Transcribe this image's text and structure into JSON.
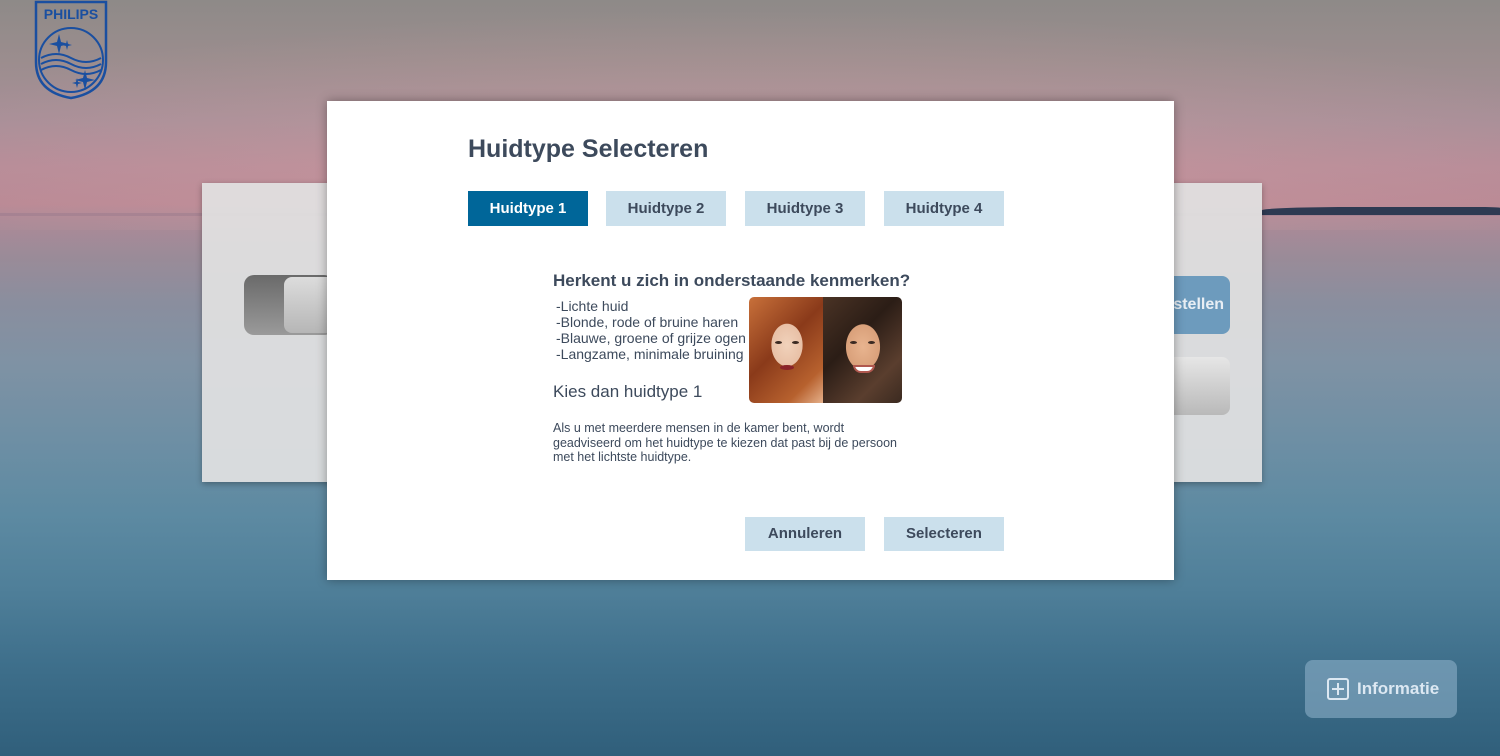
{
  "brand": {
    "name": "PHILIPS"
  },
  "background": {
    "blue_button_label": "stellen",
    "info_button_label": "Informatie"
  },
  "dialog": {
    "title": "Huidtype Selecteren",
    "tabs": [
      {
        "label": "Huidtype 1",
        "active": true
      },
      {
        "label": "Huidtype 2",
        "active": false
      },
      {
        "label": "Huidtype 3",
        "active": false
      },
      {
        "label": "Huidtype 4",
        "active": false
      }
    ],
    "question": "Herkent u zich in onderstaande kenmerken?",
    "traits": [
      "-Lichte huid",
      "-Blonde, rode of bruine haren",
      "-Blauwe, groene of grijze ogen",
      "-Langzame, minimale bruining"
    ],
    "choose_text": "Kies dan huidtype 1",
    "note": "Als u met meerdere mensen in de kamer bent, wordt geadviseerd om het huidtype te kiezen dat past bij de persoon met het lichtste huidtype.",
    "cancel_label": "Annuleren",
    "select_label": "Selecteren"
  },
  "colors": {
    "accent": "#006699",
    "tab_inactive": "#cbe0ec",
    "text": "#3d4a5c"
  }
}
